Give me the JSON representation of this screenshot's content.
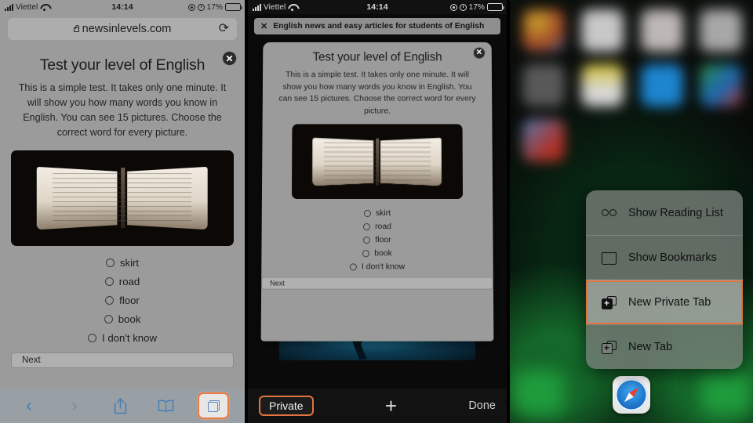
{
  "status_bar": {
    "carrier": "Viettel",
    "time": "14:14",
    "battery_percent": "17%",
    "icons": [
      "signal-bars-icon",
      "wifi-icon",
      "location-icon",
      "alarm-icon",
      "battery-icon"
    ]
  },
  "panel1": {
    "name": "safari-browser",
    "url": "newsinlevels.com",
    "lock_icon": "lock-icon",
    "reload_icon": "reload-icon",
    "reload_glyph": "⟳",
    "close_label": "✕",
    "heading": "Test your level of English",
    "intro": "This is a simple test. It takes only one minute. It will show you how many words you know in English. You can see 15 pictures. Choose the correct word for every picture.",
    "image_alt": "open-book-photo",
    "options": [
      "skirt",
      "road",
      "floor",
      "book",
      "I don't know"
    ],
    "next_label": "Next",
    "toolbar": {
      "back_glyph": "‹",
      "forward_glyph": "›",
      "share_glyph": "⇪",
      "bookmarks_icon": "book-icon",
      "tabs_icon": "tabs-icon",
      "items": [
        "back-button",
        "forward-button",
        "share-button",
        "bookmarks-button",
        "tabs-button"
      ]
    }
  },
  "panel2": {
    "name": "safari-tab-switcher",
    "tab_chip": {
      "close_glyph": "✕",
      "title": "English news and easy articles for students of English"
    },
    "card": {
      "close_label": "✕",
      "heading": "Test your level of English",
      "intro": "This is a simple test. It takes only one minute. It will show you how many words you know in English. You can see 15 pictures. Choose the correct word for every picture.",
      "options": [
        "skirt",
        "road",
        "floor",
        "book",
        "I don't know"
      ],
      "next_label": "Next"
    },
    "bottom_bar": {
      "private_label": "Private",
      "new_tab_glyph": "+",
      "done_label": "Done"
    }
  },
  "panel3": {
    "name": "ios-home-screen-context-menu",
    "app_icon_colors": [
      "#c8a02a",
      "#d7d7d7",
      "#cfc9c9",
      "#b9b9b9",
      "#6a6a6a",
      "#e8d23a",
      "#1f8fe0",
      "#2f9b48",
      "#c53a2f",
      "#3a6fc0",
      "#4a4a4a",
      "#2b2b2b"
    ],
    "dock_app": "safari-icon",
    "menu_items": [
      {
        "label": "Show Reading List",
        "icon": "glasses-icon",
        "selected": false
      },
      {
        "label": "Show Bookmarks",
        "icon": "book-icon",
        "selected": false
      },
      {
        "label": "New Private Tab",
        "icon": "new-private-tab-icon",
        "selected": true
      },
      {
        "label": "New Tab",
        "icon": "new-tab-icon",
        "selected": false
      }
    ]
  },
  "highlight_color": "#e0733f"
}
